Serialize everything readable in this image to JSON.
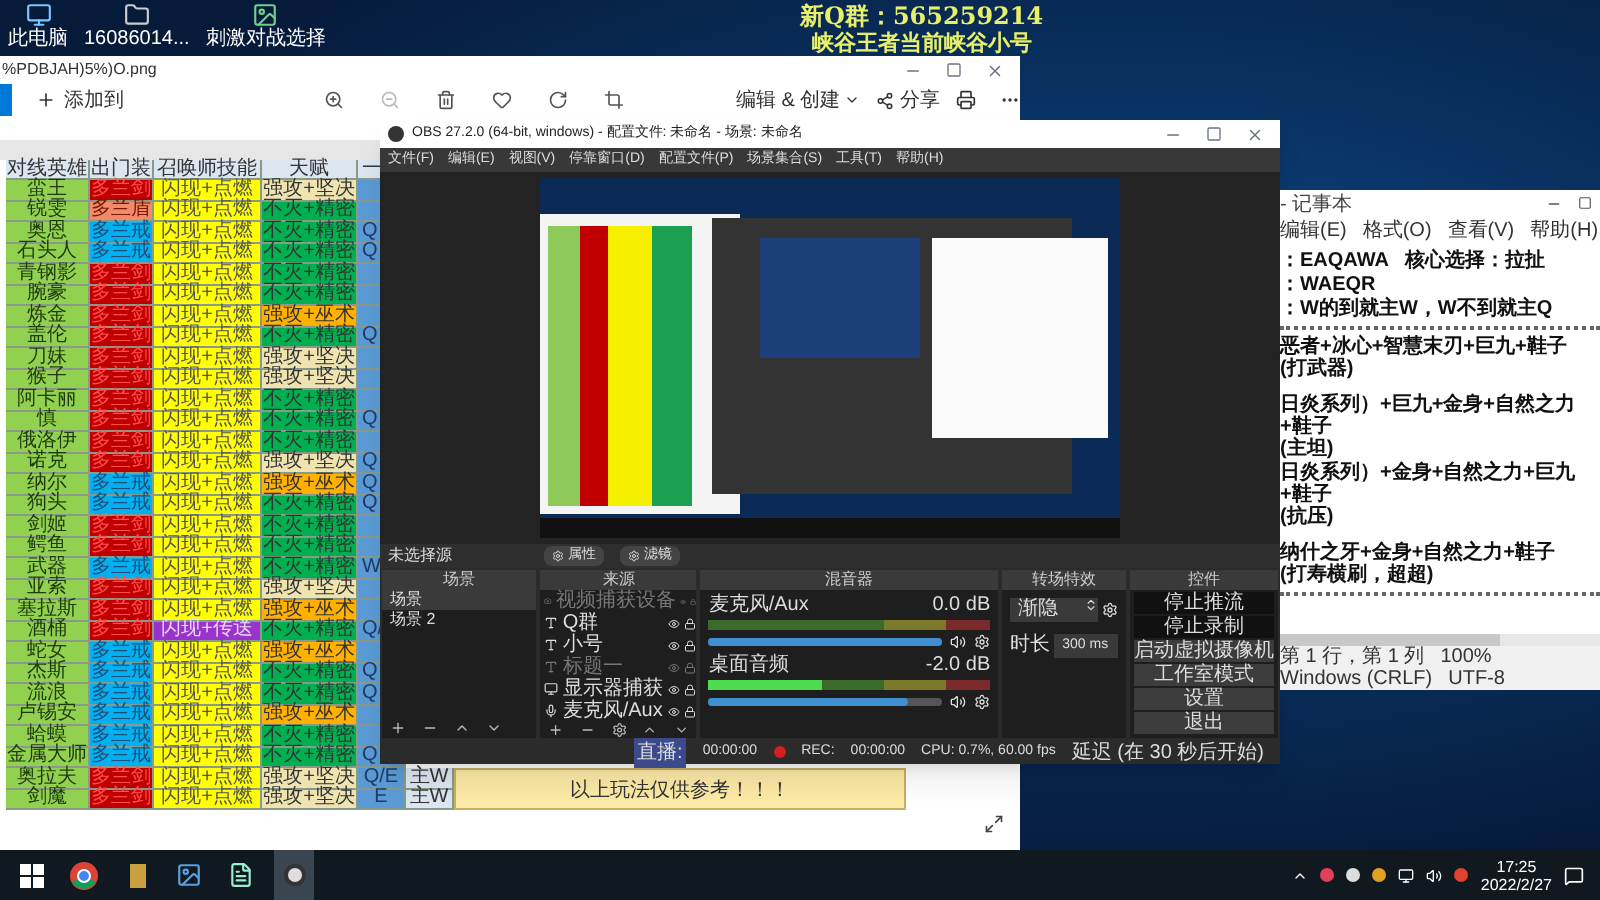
{
  "desktop": {
    "icons": [
      {
        "label": "此电脑"
      },
      {
        "label": "16086014..."
      },
      {
        "label": "刺激对战选择"
      }
    ],
    "overlay_lines": [
      "新Q群：565259214",
      "峡谷王者当前峡谷小号"
    ]
  },
  "photo_viewer": {
    "title": "%PDBJAH)5%)O.png",
    "toolbar": {
      "add_label": "添加到",
      "edit_label": "编辑 & 创建",
      "share_label": "分享"
    },
    "sheet": {
      "columns": [
        "对线英雄",
        "出门装",
        "召唤师技能",
        "天赋",
        "一"
      ],
      "rows": [
        {
          "hero": "蛮王",
          "item": {
            "text": "多兰剑",
            "color": "#c00000"
          },
          "spell": {
            "text": "闪现+点燃",
            "color": "#ffff00"
          },
          "talent": {
            "text": "强攻+坚决",
            "color": "#efe4b0"
          }
        },
        {
          "hero": "锐雯",
          "item": {
            "text": "多兰盾",
            "color": "#f08a68"
          },
          "spell": {
            "text": "闪现+点燃",
            "color": "#ffff00"
          },
          "talent": {
            "text": "不灭+精密",
            "color": "#00b050"
          }
        },
        {
          "hero": "奥恩",
          "item": {
            "text": "多兰戒",
            "color": "#00b0f0"
          },
          "spell": {
            "text": "闪现+点燃",
            "color": "#ffff00"
          },
          "talent": {
            "text": "不灭+精密",
            "color": "#00b050"
          },
          "level_one": "Q"
        },
        {
          "hero": "石头人",
          "item": {
            "text": "多兰戒",
            "color": "#00b0f0"
          },
          "spell": {
            "text": "闪现+点燃",
            "color": "#ffff00"
          },
          "talent": {
            "text": "不灭+精密",
            "color": "#00b050"
          },
          "level_one": "Q"
        },
        {
          "hero": "青钢影",
          "item": {
            "text": "多兰剑",
            "color": "#c00000"
          },
          "spell": {
            "text": "闪现+点燃",
            "color": "#ffff00"
          },
          "talent": {
            "text": "不灭+精密",
            "color": "#00b050"
          }
        },
        {
          "hero": "腕豪",
          "item": {
            "text": "多兰剑",
            "color": "#c00000"
          },
          "spell": {
            "text": "闪现+点燃",
            "color": "#ffff00"
          },
          "talent": {
            "text": "不灭+精密",
            "color": "#00b050"
          }
        },
        {
          "hero": "炼金",
          "item": {
            "text": "多兰剑",
            "color": "#c00000"
          },
          "spell": {
            "text": "闪现+点燃",
            "color": "#ffff00"
          },
          "talent": {
            "text": "强攻+巫术",
            "color": "#ffb000"
          }
        },
        {
          "hero": "盖伦",
          "item": {
            "text": "多兰剑",
            "color": "#c00000"
          },
          "spell": {
            "text": "闪现+点燃",
            "color": "#ffff00"
          },
          "talent": {
            "text": "不灭+精密",
            "color": "#00b050"
          },
          "level_one": "Q"
        },
        {
          "hero": "刀妹",
          "item": {
            "text": "多兰剑",
            "color": "#c00000"
          },
          "spell": {
            "text": "闪现+点燃",
            "color": "#ffff00"
          },
          "talent": {
            "text": "强攻+坚决",
            "color": "#efe4b0"
          }
        },
        {
          "hero": "猴子",
          "item": {
            "text": "多兰剑",
            "color": "#c00000"
          },
          "spell": {
            "text": "闪现+点燃",
            "color": "#ffff00"
          },
          "talent": {
            "text": "强攻+坚决",
            "color": "#efe4b0"
          }
        },
        {
          "hero": "阿卡丽",
          "item": {
            "text": "多兰剑",
            "color": "#c00000"
          },
          "spell": {
            "text": "闪现+点燃",
            "color": "#ffff00"
          },
          "talent": {
            "text": "不灭+精密",
            "color": "#00b050"
          }
        },
        {
          "hero": "慎",
          "item": {
            "text": "多兰剑",
            "color": "#c00000"
          },
          "spell": {
            "text": "闪现+点燃",
            "color": "#ffff00"
          },
          "talent": {
            "text": "不灭+精密",
            "color": "#00b050"
          },
          "level_one": "Q"
        },
        {
          "hero": "俄洛伊",
          "item": {
            "text": "多兰剑",
            "color": "#c00000"
          },
          "spell": {
            "text": "闪现+点燃",
            "color": "#ffff00"
          },
          "talent": {
            "text": "不灭+精密",
            "color": "#00b050"
          }
        },
        {
          "hero": "诺克",
          "item": {
            "text": "多兰剑",
            "color": "#c00000"
          },
          "spell": {
            "text": "闪现+点燃",
            "color": "#ffff00"
          },
          "talent": {
            "text": "强攻+坚决",
            "color": "#efe4b0"
          },
          "level_one": "Q"
        },
        {
          "hero": "纳尔",
          "item": {
            "text": "多兰戒",
            "color": "#00b0f0"
          },
          "spell": {
            "text": "闪现+点燃",
            "color": "#ffff00"
          },
          "talent": {
            "text": "强攻+巫术",
            "color": "#ffb000"
          },
          "level_one": "Q"
        },
        {
          "hero": "狗头",
          "item": {
            "text": "多兰戒",
            "color": "#00b0f0"
          },
          "spell": {
            "text": "闪现+点燃",
            "color": "#ffff00"
          },
          "talent": {
            "text": "不灭+精密",
            "color": "#00b050"
          },
          "level_one": "Q"
        },
        {
          "hero": "剑姬",
          "item": {
            "text": "多兰剑",
            "color": "#c00000"
          },
          "spell": {
            "text": "闪现+点燃",
            "color": "#ffff00"
          },
          "talent": {
            "text": "不灭+精密",
            "color": "#00b050"
          }
        },
        {
          "hero": "鳄鱼",
          "item": {
            "text": "多兰剑",
            "color": "#c00000"
          },
          "spell": {
            "text": "闪现+点燃",
            "color": "#ffff00"
          },
          "talent": {
            "text": "不灭+精密",
            "color": "#00b050"
          }
        },
        {
          "hero": "武器",
          "item": {
            "text": "多兰戒",
            "color": "#00b0f0"
          },
          "spell": {
            "text": "闪现+点燃",
            "color": "#ffff00"
          },
          "talent": {
            "text": "不灭+精密",
            "color": "#00b050"
          },
          "level_one": "W"
        },
        {
          "hero": "亚索",
          "item": {
            "text": "多兰剑",
            "color": "#c00000"
          },
          "spell": {
            "text": "闪现+点燃",
            "color": "#ffff00"
          },
          "talent": {
            "text": "强攻+坚决",
            "color": "#efe4b0"
          }
        },
        {
          "hero": "塞拉斯",
          "item": {
            "text": "多兰剑",
            "color": "#c00000"
          },
          "spell": {
            "text": "闪现+点燃",
            "color": "#ffff00"
          },
          "talent": {
            "text": "强攻+巫术",
            "color": "#ffb000"
          }
        },
        {
          "hero": "酒桶",
          "item": {
            "text": "多兰剑",
            "color": "#c00000"
          },
          "spell": {
            "text": "闪现+传送",
            "color": "#9933cc"
          },
          "talent": {
            "text": "不灭+精密",
            "color": "#00b050"
          },
          "level_one": "Q/"
        },
        {
          "hero": "蛇女",
          "item": {
            "text": "多兰戒",
            "color": "#00b0f0"
          },
          "spell": {
            "text": "闪现+点燃",
            "color": "#ffff00"
          },
          "talent": {
            "text": "强攻+巫术",
            "color": "#ffb000"
          }
        },
        {
          "hero": "杰斯",
          "item": {
            "text": "多兰戒",
            "color": "#00b0f0"
          },
          "spell": {
            "text": "闪现+点燃",
            "color": "#ffff00"
          },
          "talent": {
            "text": "不灭+精密",
            "color": "#00b050"
          },
          "level_one": "Q"
        },
        {
          "hero": "流浪",
          "item": {
            "text": "多兰戒",
            "color": "#00b0f0"
          },
          "spell": {
            "text": "闪现+点燃",
            "color": "#ffff00"
          },
          "talent": {
            "text": "不灭+精密",
            "color": "#00b050"
          },
          "level_one": "Q"
        },
        {
          "hero": "卢锡安",
          "item": {
            "text": "多兰戒",
            "color": "#00b0f0"
          },
          "spell": {
            "text": "闪现+点燃",
            "color": "#ffff00"
          },
          "talent": {
            "text": "强攻+巫术",
            "color": "#ffb000"
          }
        },
        {
          "hero": "蛤蟆",
          "item": {
            "text": "多兰戒",
            "color": "#00b0f0"
          },
          "spell": {
            "text": "闪现+点燃",
            "color": "#ffff00"
          },
          "talent": {
            "text": "不灭+精密",
            "color": "#00b050"
          }
        },
        {
          "hero": "金属大师",
          "item": {
            "text": "多兰戒",
            "color": "#00b0f0"
          },
          "spell": {
            "text": "闪现+点燃",
            "color": "#ffff00"
          },
          "talent": {
            "text": "不灭+精密",
            "color": "#00b050"
          },
          "level_one": "Q"
        },
        {
          "hero": "奥拉夫",
          "item": {
            "text": "多兰剑",
            "color": "#c00000"
          },
          "spell": {
            "text": "闪现+点燃",
            "color": "#ffff00"
          },
          "talent": {
            "text": "强攻+坚决",
            "color": "#efe4b0"
          },
          "level_one": "Q/E",
          "column_6": "主W"
        },
        {
          "hero": "剑魔",
          "item": {
            "text": "多兰剑",
            "color": "#c00000"
          },
          "spell": {
            "text": "闪现+点燃",
            "color": "#ffff00"
          },
          "talent": {
            "text": "强攻+坚决",
            "color": "#efe4b0"
          },
          "level_one": "E",
          "column_6": "主W"
        }
      ],
      "note": "以上玩法仅供参考！！！"
    }
  },
  "obs": {
    "title": "OBS 27.2.0 (64-bit, windows) - 配置文件: 未命名 - 场景: 未命名",
    "menu": [
      "文件(F)",
      "编辑(E)",
      "视图(V)",
      "停靠窗口(D)",
      "配置文件(P)",
      "场景集合(S)",
      "工具(T)",
      "帮助(H)"
    ],
    "source_bar": {
      "label": "未选择源",
      "buttons": [
        "属性",
        "滤镜"
      ]
    },
    "scenes": {
      "title": "场景",
      "items": [
        {
          "label": "场景",
          "selected": true
        },
        {
          "label": "场景 2",
          "selected": false
        }
      ]
    },
    "sources": {
      "title": "来源",
      "items": [
        {
          "label": "视频捕获设备",
          "kind": "camera",
          "visible": false
        },
        {
          "label": "Q群",
          "kind": "text",
          "visible": true
        },
        {
          "label": "小号",
          "kind": "text",
          "visible": true
        },
        {
          "label": "标题一",
          "kind": "text",
          "visible": false
        },
        {
          "label": "显示器捕获",
          "kind": "monitor",
          "visible": true
        },
        {
          "label": "麦克风/Aux",
          "kind": "mic",
          "visible": true
        }
      ]
    },
    "mixer": {
      "title": "混音器",
      "channels": [
        {
          "name": "麦克风/Aux",
          "reading": "0.0 dB",
          "level": 1
        },
        {
          "name": "桌面音频",
          "reading": "-2.0 dB",
          "meter": {
            "level": 0.4
          },
          "level": 0.85
        }
      ]
    },
    "transitions": {
      "title": "转场特效",
      "type": "渐隐",
      "duration_label": "时长",
      "duration": "300 ms"
    },
    "controls": {
      "title": "控件",
      "buttons": [
        {
          "label": "停止推流",
          "active": true
        },
        {
          "label": "停止录制",
          "active": true
        },
        {
          "label": "启动虚拟摄像机",
          "active": false
        },
        {
          "label": "工作室模式",
          "active": false
        },
        {
          "label": "设置",
          "active": false
        },
        {
          "label": "退出",
          "active": false
        }
      ]
    },
    "status": {
      "live_label": "直播:",
      "live_time": "00:00:00",
      "rec_label": "REC:",
      "rec_time": "00:00:00",
      "cpu": "CPU: 0.7%, 60.00 fps",
      "delay": "延迟 (在 30 秒后开始)"
    }
  },
  "notepad": {
    "title": "- 记事本",
    "menu": [
      "编辑(E)",
      "格式(O)",
      "查看(V)",
      "帮助(H)"
    ],
    "lines": [
      {
        "kind": "text",
        "text": "：EAQAWA",
        "note": "核心选择：拉扯"
      },
      {
        "kind": "text",
        "text": "：WAEQR"
      },
      {
        "kind": "text",
        "text": "：W的到就主W，W不到就主Q"
      },
      {
        "kind": "rule"
      },
      {
        "kind": "text",
        "text": "恶者+冰心+智慧末刃+巨九+鞋子",
        "note": "(打武器)"
      },
      {
        "kind": "blank"
      },
      {
        "kind": "text",
        "text": "日炎系列）+巨九+金身+自然之力+鞋子",
        "note": "(主坦)"
      },
      {
        "kind": "text",
        "text": "日炎系列）+金身+自然之力+巨九+鞋子",
        "note": "(抗压)"
      },
      {
        "kind": "blank"
      },
      {
        "kind": "text",
        "text": "纳什之牙+金身+自然之力+鞋子",
        "note": "(打寿横刷，超超)"
      },
      {
        "kind": "rule"
      }
    ],
    "status": [
      "第 1 行，第 1 列",
      "100%",
      "Windows (CRLF)",
      "UTF-8"
    ]
  },
  "taskbar": {
    "time": "17:25",
    "date": "2022/2/27"
  }
}
